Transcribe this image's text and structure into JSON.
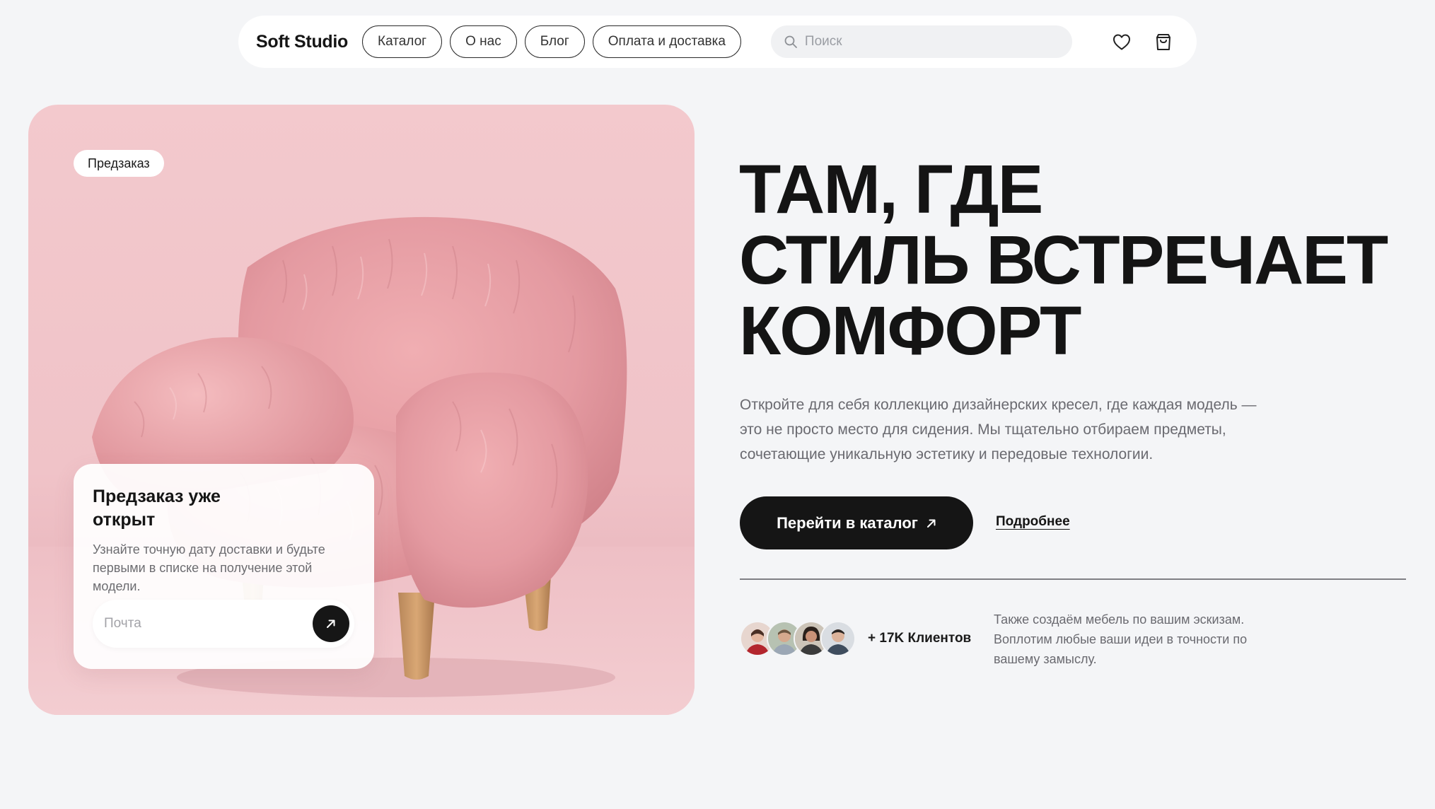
{
  "nav": {
    "logo": "Soft Studio",
    "links": [
      "Каталог",
      "О нас",
      "Блог",
      "Оплата и доставка"
    ],
    "search_placeholder": "Поиск",
    "favorites_icon": "heart-icon",
    "cart_icon": "shopping-bag-icon"
  },
  "hero_card": {
    "badge": "Предзаказ",
    "preorder": {
      "title": "Предзаказ уже открыт",
      "text": "Узнайте точную дату доставки и будьте первыми в списке на получение этой модели.",
      "email_placeholder": "Почта",
      "submit_icon": "arrow-up-right-icon"
    }
  },
  "hero": {
    "headline_lines": [
      "ТАМ, ГДЕ",
      "СТИЛЬ ВСТРЕЧАЕТ",
      "КОМФОРТ"
    ],
    "description": "Откройте для себя коллекцию дизайнерских кресел, где каждая модель — это не просто место для сидения. Мы тщательно отбираем предметы, сочетающие уникальную эстетику и передовые технологии.",
    "cta_label": "Перейти в каталог",
    "more_label": "Подробнее",
    "clients_label": "+ 17K Клиентов",
    "side_note": "Также создаём мебель по вашим эскизам. Воплотим любые ваши идеи в точности по вашему замыслу."
  },
  "colors": {
    "background": "#f4f5f7",
    "card_pink": "#f3c9cd",
    "dark": "#151515",
    "muted_text": "#6a6a70"
  }
}
